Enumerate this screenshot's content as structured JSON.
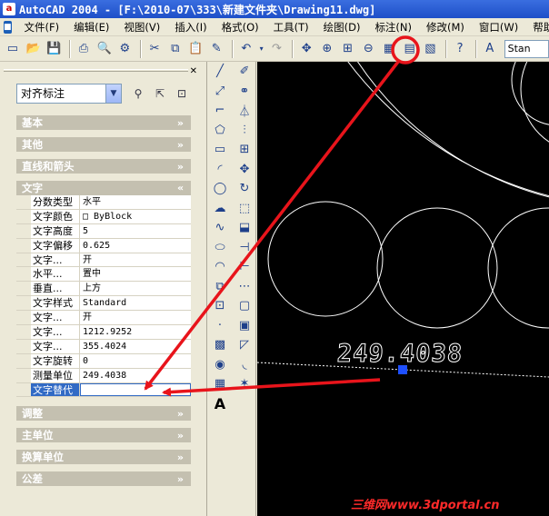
{
  "window": {
    "title": "AutoCAD 2004 - [F:\\2010-07\\333\\新建文件夹\\Drawing11.dwg]"
  },
  "menu": [
    "文件(F)",
    "编辑(E)",
    "视图(V)",
    "插入(I)",
    "格式(O)",
    "工具(T)",
    "绘图(D)",
    "标注(N)",
    "修改(M)",
    "窗口(W)",
    "帮助"
  ],
  "toolbar": {
    "text_style": "Stan"
  },
  "properties": {
    "selection": "对齐标注",
    "sections": {
      "basic": "基本",
      "other": "其他",
      "lines_arrows": "直线和箭头",
      "text": "文字",
      "fit": "调整",
      "primary_units": "主单位",
      "alt_units": "换算单位",
      "tolerances": "公差"
    },
    "text_rows": [
      {
        "name": "分数类型",
        "value": "水平"
      },
      {
        "name": "文字颜色",
        "value": "□ ByBlock"
      },
      {
        "name": "文字高度",
        "value": "5"
      },
      {
        "name": "文字偏移",
        "value": "0.625"
      },
      {
        "name": "文字...",
        "value": "开"
      },
      {
        "name": "水平...",
        "value": "置中"
      },
      {
        "name": "垂直...",
        "value": "上方"
      },
      {
        "name": "文字样式",
        "value": "Standard"
      },
      {
        "name": "文字...",
        "value": "开"
      },
      {
        "name": "文字...",
        "value": "1212.9252"
      },
      {
        "name": "文字...",
        "value": "355.4024"
      },
      {
        "name": "文字旋转",
        "value": "0"
      },
      {
        "name": "测量单位",
        "value": "249.4038"
      },
      {
        "name": "文字替代",
        "value": ""
      }
    ]
  },
  "canvas": {
    "dimension_text": "249.4038"
  },
  "watermark": "三维网www.3dportal.cn",
  "colors": {
    "annotation": "#E8141B",
    "selection": "#316AC5",
    "canvas_bg": "#000000"
  }
}
